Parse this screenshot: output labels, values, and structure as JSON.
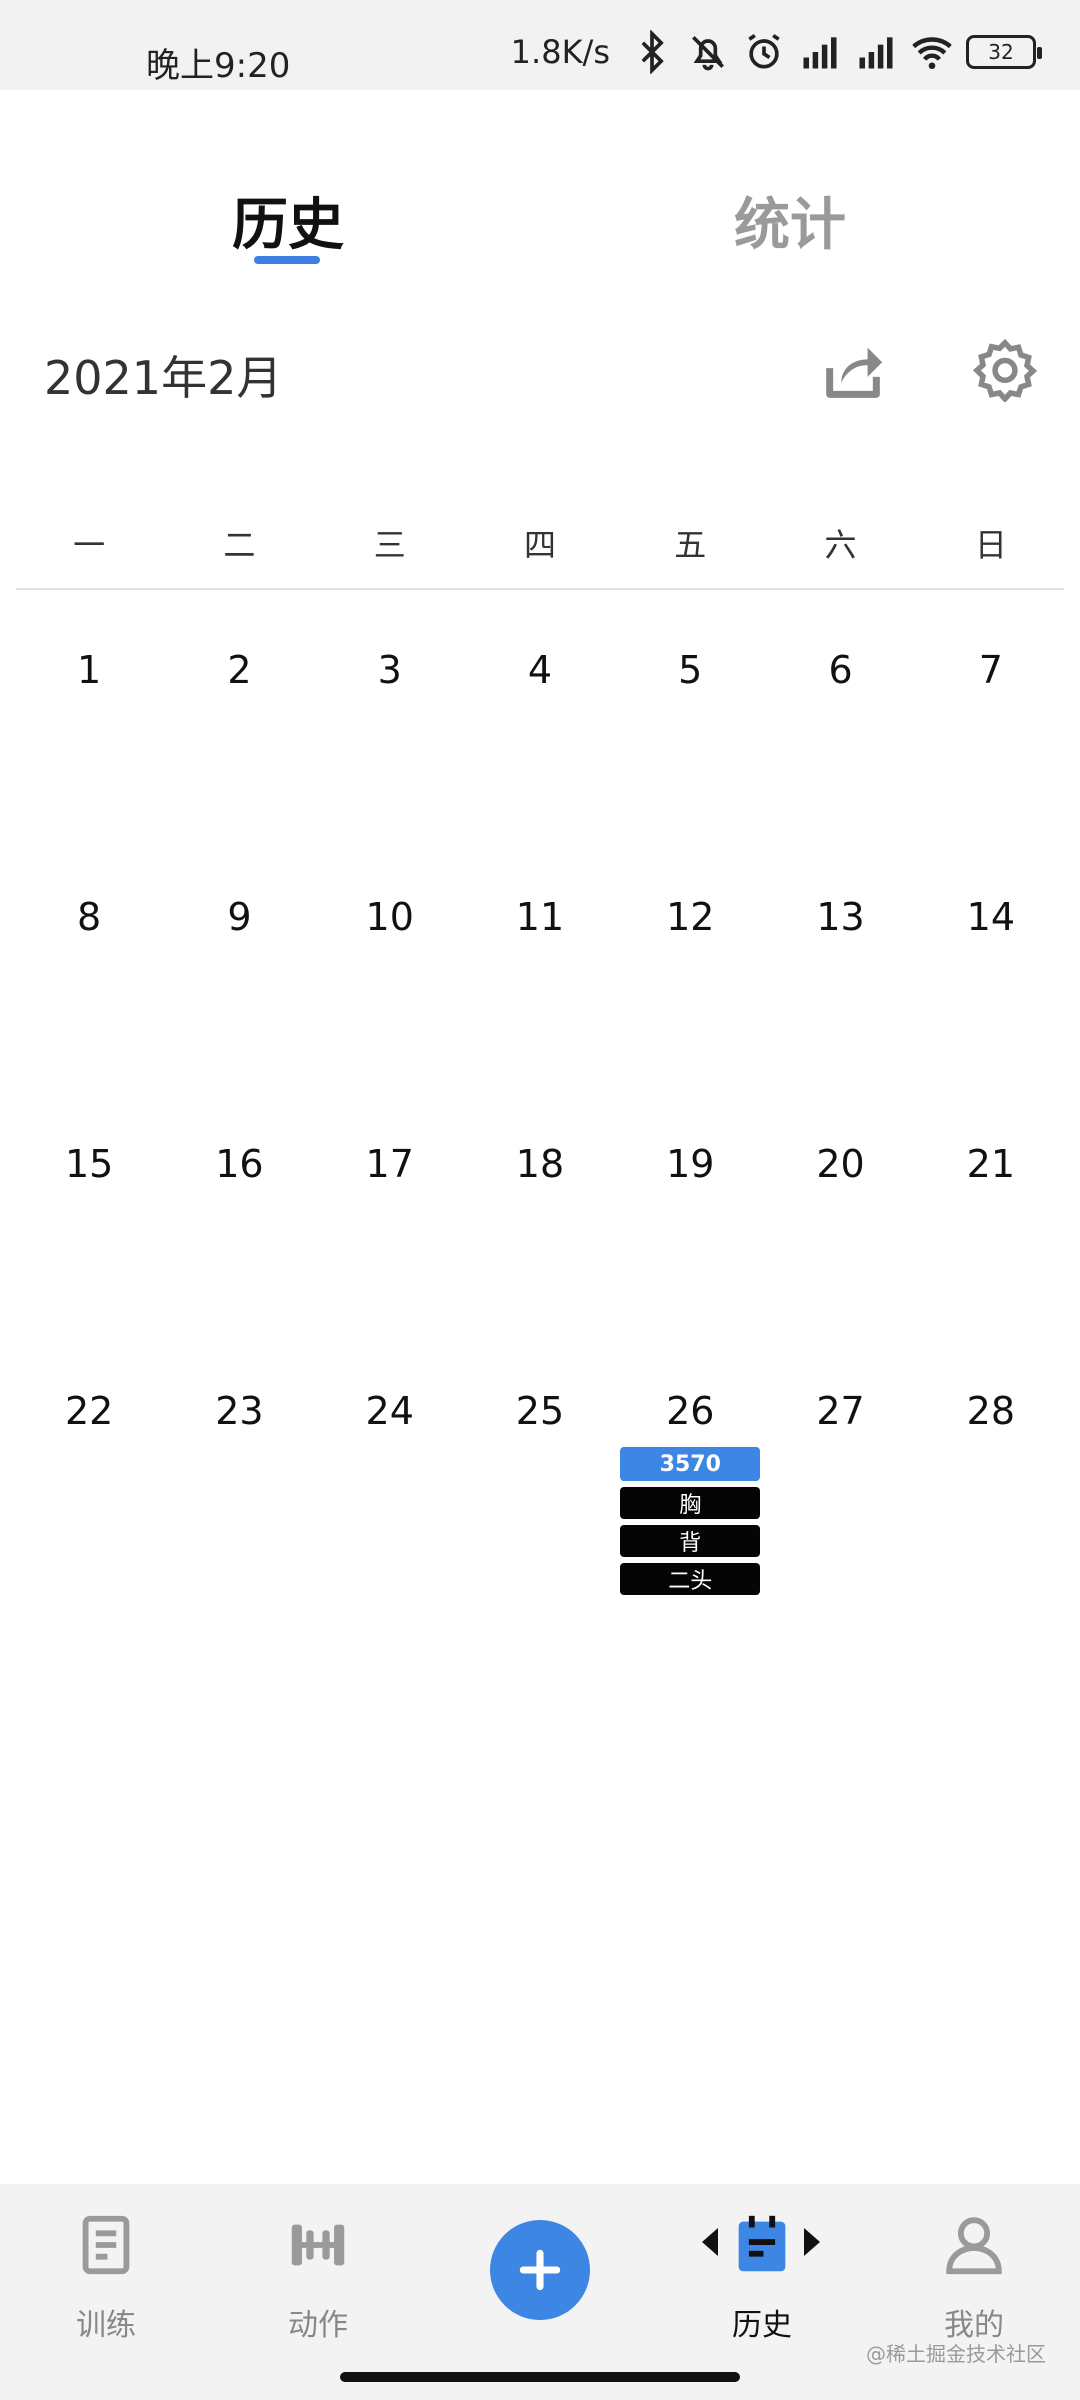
{
  "status_bar": {
    "time": "晚上9:20",
    "net_speed": "1.8K/s",
    "battery": "32",
    "icons": [
      "bluetooth-icon",
      "mute-icon",
      "alarm-icon",
      "hd-signal-icon",
      "signal-icon",
      "wifi-icon",
      "battery-icon"
    ]
  },
  "tabs": [
    {
      "label": "历史",
      "active": true
    },
    {
      "label": "统计",
      "active": false
    }
  ],
  "header": {
    "month_title": "2021年2月",
    "share_icon": "share-icon",
    "settings_icon": "gear-icon"
  },
  "calendar": {
    "weekdays": [
      "一",
      "二",
      "三",
      "四",
      "五",
      "六",
      "日"
    ],
    "weeks": [
      [
        "1",
        "2",
        "3",
        "4",
        "5",
        "6",
        "7"
      ],
      [
        "8",
        "9",
        "10",
        "11",
        "12",
        "13",
        "14"
      ],
      [
        "15",
        "16",
        "17",
        "18",
        "19",
        "20",
        "21"
      ],
      [
        "22",
        "23",
        "24",
        "25",
        "26",
        "27",
        "28"
      ]
    ],
    "records": {
      "day_26": {
        "total": "3570",
        "tags": [
          "胸",
          "背",
          "二头"
        ]
      }
    }
  },
  "bottom_nav": [
    {
      "label": "训练",
      "icon": "document-icon"
    },
    {
      "label": "动作",
      "icon": "dumbbell-icon"
    },
    {
      "label": "",
      "icon": "plus-icon"
    },
    {
      "label": "历史",
      "icon": "calendar-list-icon"
    },
    {
      "label": "我的",
      "icon": "user-icon"
    }
  ],
  "watermark": "@稀土掘金技术社区",
  "colors": {
    "accent": "#3d86e3",
    "tag_bg": "#050505",
    "inactive_tab": "#9a9a9a"
  }
}
